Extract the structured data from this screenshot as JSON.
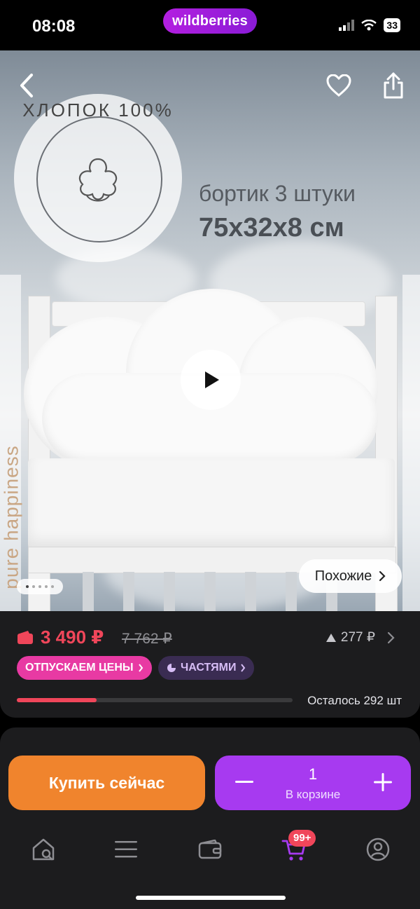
{
  "status_bar": {
    "time": "08:08",
    "brand": "wildberries",
    "battery": "33"
  },
  "hero": {
    "badge_text": "ХЛОПОК 100%",
    "title": "бортик 3 штуки",
    "size": "75х32х8 см",
    "side_text": "pure happiness",
    "similar_label": "Похожие",
    "slides_total": 5,
    "slide_current": 1
  },
  "price": {
    "current": "3 490 ₽",
    "old": "7 762 ₽",
    "points": "277 ₽",
    "chip_sale": "ОТПУСКАЕМ ЦЕНЫ",
    "chip_parts": "ЧАСТЯМИ",
    "stock_text": "Осталось 292 шт",
    "stock_fraction": 0.29
  },
  "actions": {
    "buy_now": "Купить сейчас",
    "cart_qty": "1",
    "cart_label": "В корзине"
  },
  "tabbar": {
    "cart_badge": "99+",
    "items": [
      "home-search",
      "catalog",
      "wallet",
      "cart",
      "profile"
    ]
  },
  "colors": {
    "accent_purple": "#a73af0",
    "buy_orange": "#f0842d",
    "price_red": "#f0465a",
    "chip_pink": "#e83aa3"
  }
}
